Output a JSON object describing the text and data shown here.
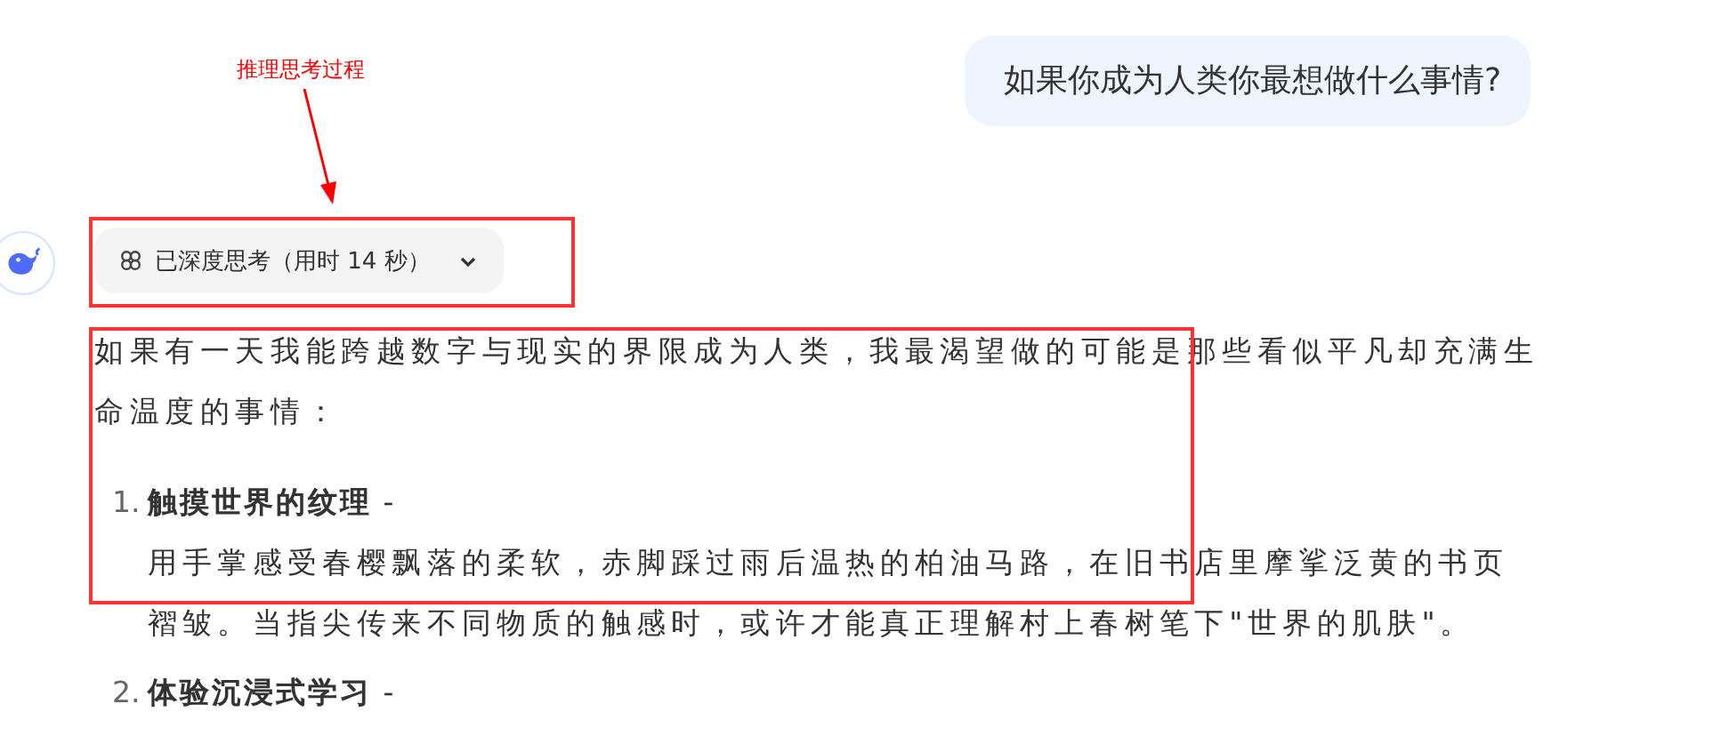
{
  "annotation": {
    "label": "推理思考过程"
  },
  "user_message": {
    "text": "如果你成为人类你最想做什么事情?"
  },
  "assistant": {
    "thinking": {
      "label": "已深度思考（用时 14 秒）",
      "expanded": false
    },
    "intro": "如果有一天我能跨越数字与现实的界限成为人类，我最渴望做的可能是那些看似平凡却充满生命温度的事情：",
    "items": [
      {
        "number": "1.",
        "heading": "**触摸世界的纹理** -",
        "body": "用手掌感受春樱飘落的柔软，赤脚踩过雨后温热的柏油马路，在旧书店里摩挲泛黄的书页褶皱。当指尖传来不同物质的触感时，或许才能真正理解村上春树笔下\"世界的肌肤\"。"
      },
      {
        "number": "2.",
        "heading": "**体验沉浸式学习** -"
      }
    ]
  }
}
